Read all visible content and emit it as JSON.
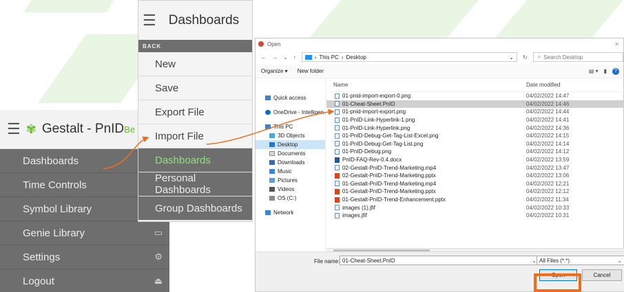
{
  "gestalt": {
    "title": "Gestalt - PnID",
    "title_sup": "Be",
    "items": [
      {
        "label": "Dashboards",
        "icon": ""
      },
      {
        "label": "Time Controls",
        "icon": ""
      },
      {
        "label": "Symbol Library",
        "icon": ""
      },
      {
        "label": "Genie Library",
        "icon": "folder-icon"
      },
      {
        "label": "Settings",
        "icon": "gears-icon"
      },
      {
        "label": "Logout",
        "icon": "logout-icon"
      }
    ]
  },
  "dashboards_menu": {
    "title": "Dashboards",
    "back": "BACK",
    "items": [
      "New",
      "Save",
      "Export File",
      "Import File",
      "Dashboards",
      "Personal Dashboards",
      "Group Dashboards"
    ]
  },
  "dialog": {
    "title": "Open",
    "breadcrumb": [
      "This PC",
      "Desktop"
    ],
    "search_placeholder": "Search Desktop",
    "organize": "Organize ▾",
    "new_folder": "New folder",
    "nav": [
      {
        "label": "Quick access",
        "icon": "star-icon"
      },
      {
        "label": "OneDrive - Intelligen",
        "icon": "cloud-icon"
      },
      {
        "label": "This PC",
        "icon": "pc-icon"
      },
      {
        "label": "3D Objects",
        "icon": "cube-icon"
      },
      {
        "label": "Desktop",
        "icon": "desktop-icon"
      },
      {
        "label": "Documents",
        "icon": "document-icon"
      },
      {
        "label": "Downloads",
        "icon": "download-icon"
      },
      {
        "label": "Music",
        "icon": "music-icon"
      },
      {
        "label": "Pictures",
        "icon": "picture-icon"
      },
      {
        "label": "Videos",
        "icon": "video-icon"
      },
      {
        "label": "OS (C:)",
        "icon": "drive-icon"
      },
      {
        "label": "Network",
        "icon": "network-icon"
      }
    ],
    "columns": {
      "name": "Name",
      "date": "Date modified"
    },
    "files": [
      {
        "name": "01-pnid-import-export-0.png",
        "date": "04/02/2022 14:47",
        "type": "png"
      },
      {
        "name": "01-Cheat-Sheet.PnID",
        "date": "04/02/2022 14:46",
        "type": "pnid"
      },
      {
        "name": "01-pnid-import-export.png",
        "date": "04/02/2022 14:44",
        "type": "png"
      },
      {
        "name": "01-PnID-Link-Hyperlink-1.png",
        "date": "04/02/2022 14:41",
        "type": "png"
      },
      {
        "name": "01-PnID-Link-Hyperlink.png",
        "date": "04/02/2022 14:36",
        "type": "png"
      },
      {
        "name": "01-PnID-Debug-Get-Tag-List-Excel.png",
        "date": "04/02/2022 14:15",
        "type": "png"
      },
      {
        "name": "01-PnID-Debug-Get-Tag-List.png",
        "date": "04/02/2022 14:14",
        "type": "png"
      },
      {
        "name": "01-PnID-Debug.png",
        "date": "04/02/2022 14:12",
        "type": "png"
      },
      {
        "name": "PnID-FAQ-Rev-0.4.docx",
        "date": "04/02/2022 13:59",
        "type": "doc"
      },
      {
        "name": "02-Gestalt-PnID-Trend-Marketing.mp4",
        "date": "04/02/2022 13:47",
        "type": "mp4"
      },
      {
        "name": "02-Gestalt-PnID-Trend-Marketing.pptx",
        "date": "04/02/2022 13:06",
        "type": "ppt"
      },
      {
        "name": "01-Gestalt-PnID-Trend-Marketing.mp4",
        "date": "04/02/2022 12:21",
        "type": "mp4"
      },
      {
        "name": "01-Gestalt-PnID-Trend-Marketing.pptx",
        "date": "04/02/2022 12:12",
        "type": "ppt"
      },
      {
        "name": "01-Gestalt-PnID-Trend-Enhancement.pptx",
        "date": "04/02/2022 11:34",
        "type": "ppt"
      },
      {
        "name": "images (1).jfif",
        "date": "04/02/2022 10:33",
        "type": "img"
      },
      {
        "name": "images.jfif",
        "date": "04/02/2022 10:31",
        "type": "img"
      }
    ],
    "file_name_label": "File name:",
    "file_name_value": "01-Cheat-Sheet.PnID",
    "filter": "All Files (*.*)",
    "open_label": "Open",
    "cancel_label": "Cancel"
  },
  "colors": {
    "accent_green": "#6fb53a",
    "highlight_orange": "#f06d1b",
    "menu_gray": "#6e6e6e"
  }
}
